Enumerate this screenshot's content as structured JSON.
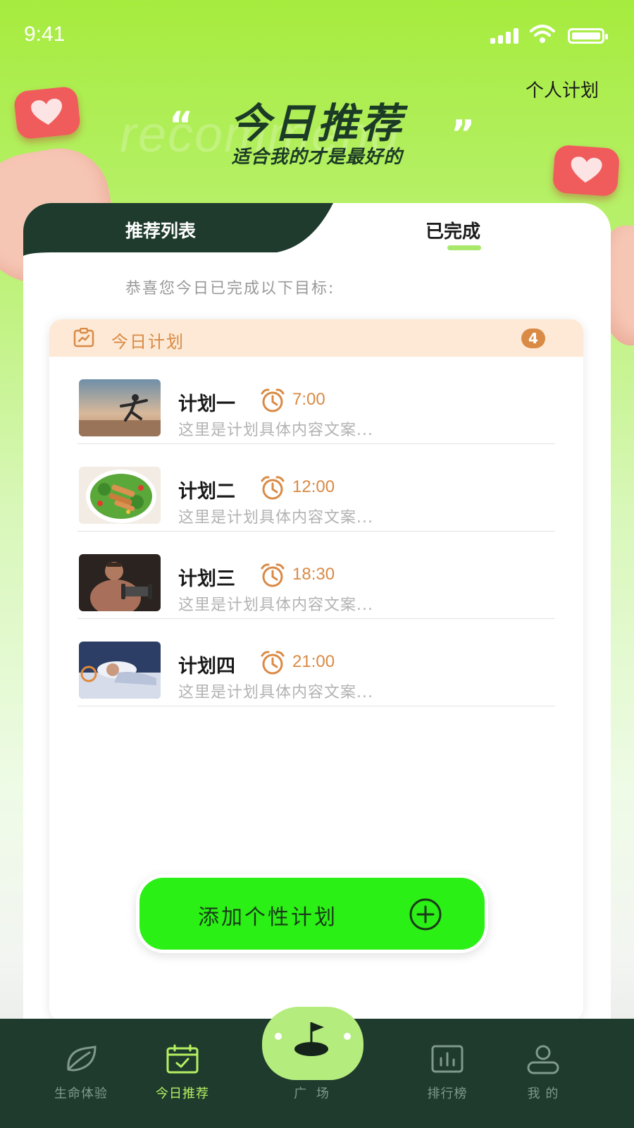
{
  "status_bar": {
    "time": "9:41"
  },
  "header": {
    "personal_plan_link": "个人计划",
    "title": "今日推荐",
    "subtitle": "适合我的才是最好的",
    "watermark": "recommend",
    "quote_open": "“",
    "quote_close": "”"
  },
  "tabs": [
    {
      "label": "推荐列表",
      "active": false
    },
    {
      "label": "已完成",
      "active": true
    }
  ],
  "congrats_text": "恭喜您今日已完成以下目标:",
  "plan_panel": {
    "title": "今日计划",
    "count": "4",
    "items": [
      {
        "name": "计划一",
        "time": "7:00",
        "desc": "这里是计划具体内容文案...",
        "image": "runner-stretching-photo"
      },
      {
        "name": "计划二",
        "time": "12:00",
        "desc": "这里是计划具体内容文案...",
        "image": "salad-plate-photo"
      },
      {
        "name": "计划三",
        "time": "18:30",
        "desc": "这里是计划具体内容文案...",
        "image": "man-with-dumbbell-photo"
      },
      {
        "name": "计划四",
        "time": "21:00",
        "desc": "这里是计划具体内容文案...",
        "image": "person-sleeping-photo"
      }
    ]
  },
  "add_button": {
    "label": "添加个性计划",
    "icon": "plus-circle-icon"
  },
  "bottom_nav": {
    "items": [
      {
        "label": "生命体验",
        "icon": "leaf-icon",
        "active": false
      },
      {
        "label": "今日推荐",
        "icon": "calendar-check-icon",
        "active": true
      },
      {
        "label": "广 场",
        "icon": "golf-flag-icon",
        "active": false
      },
      {
        "label": "排行榜",
        "icon": "bar-chart-icon",
        "active": false
      },
      {
        "label": "我 的",
        "icon": "user-icon",
        "active": false
      }
    ]
  },
  "colors": {
    "accent_green": "#2bf015",
    "dark_green": "#1e3b2d",
    "orange": "#d98a45",
    "nav_active": "#b6ef63"
  }
}
